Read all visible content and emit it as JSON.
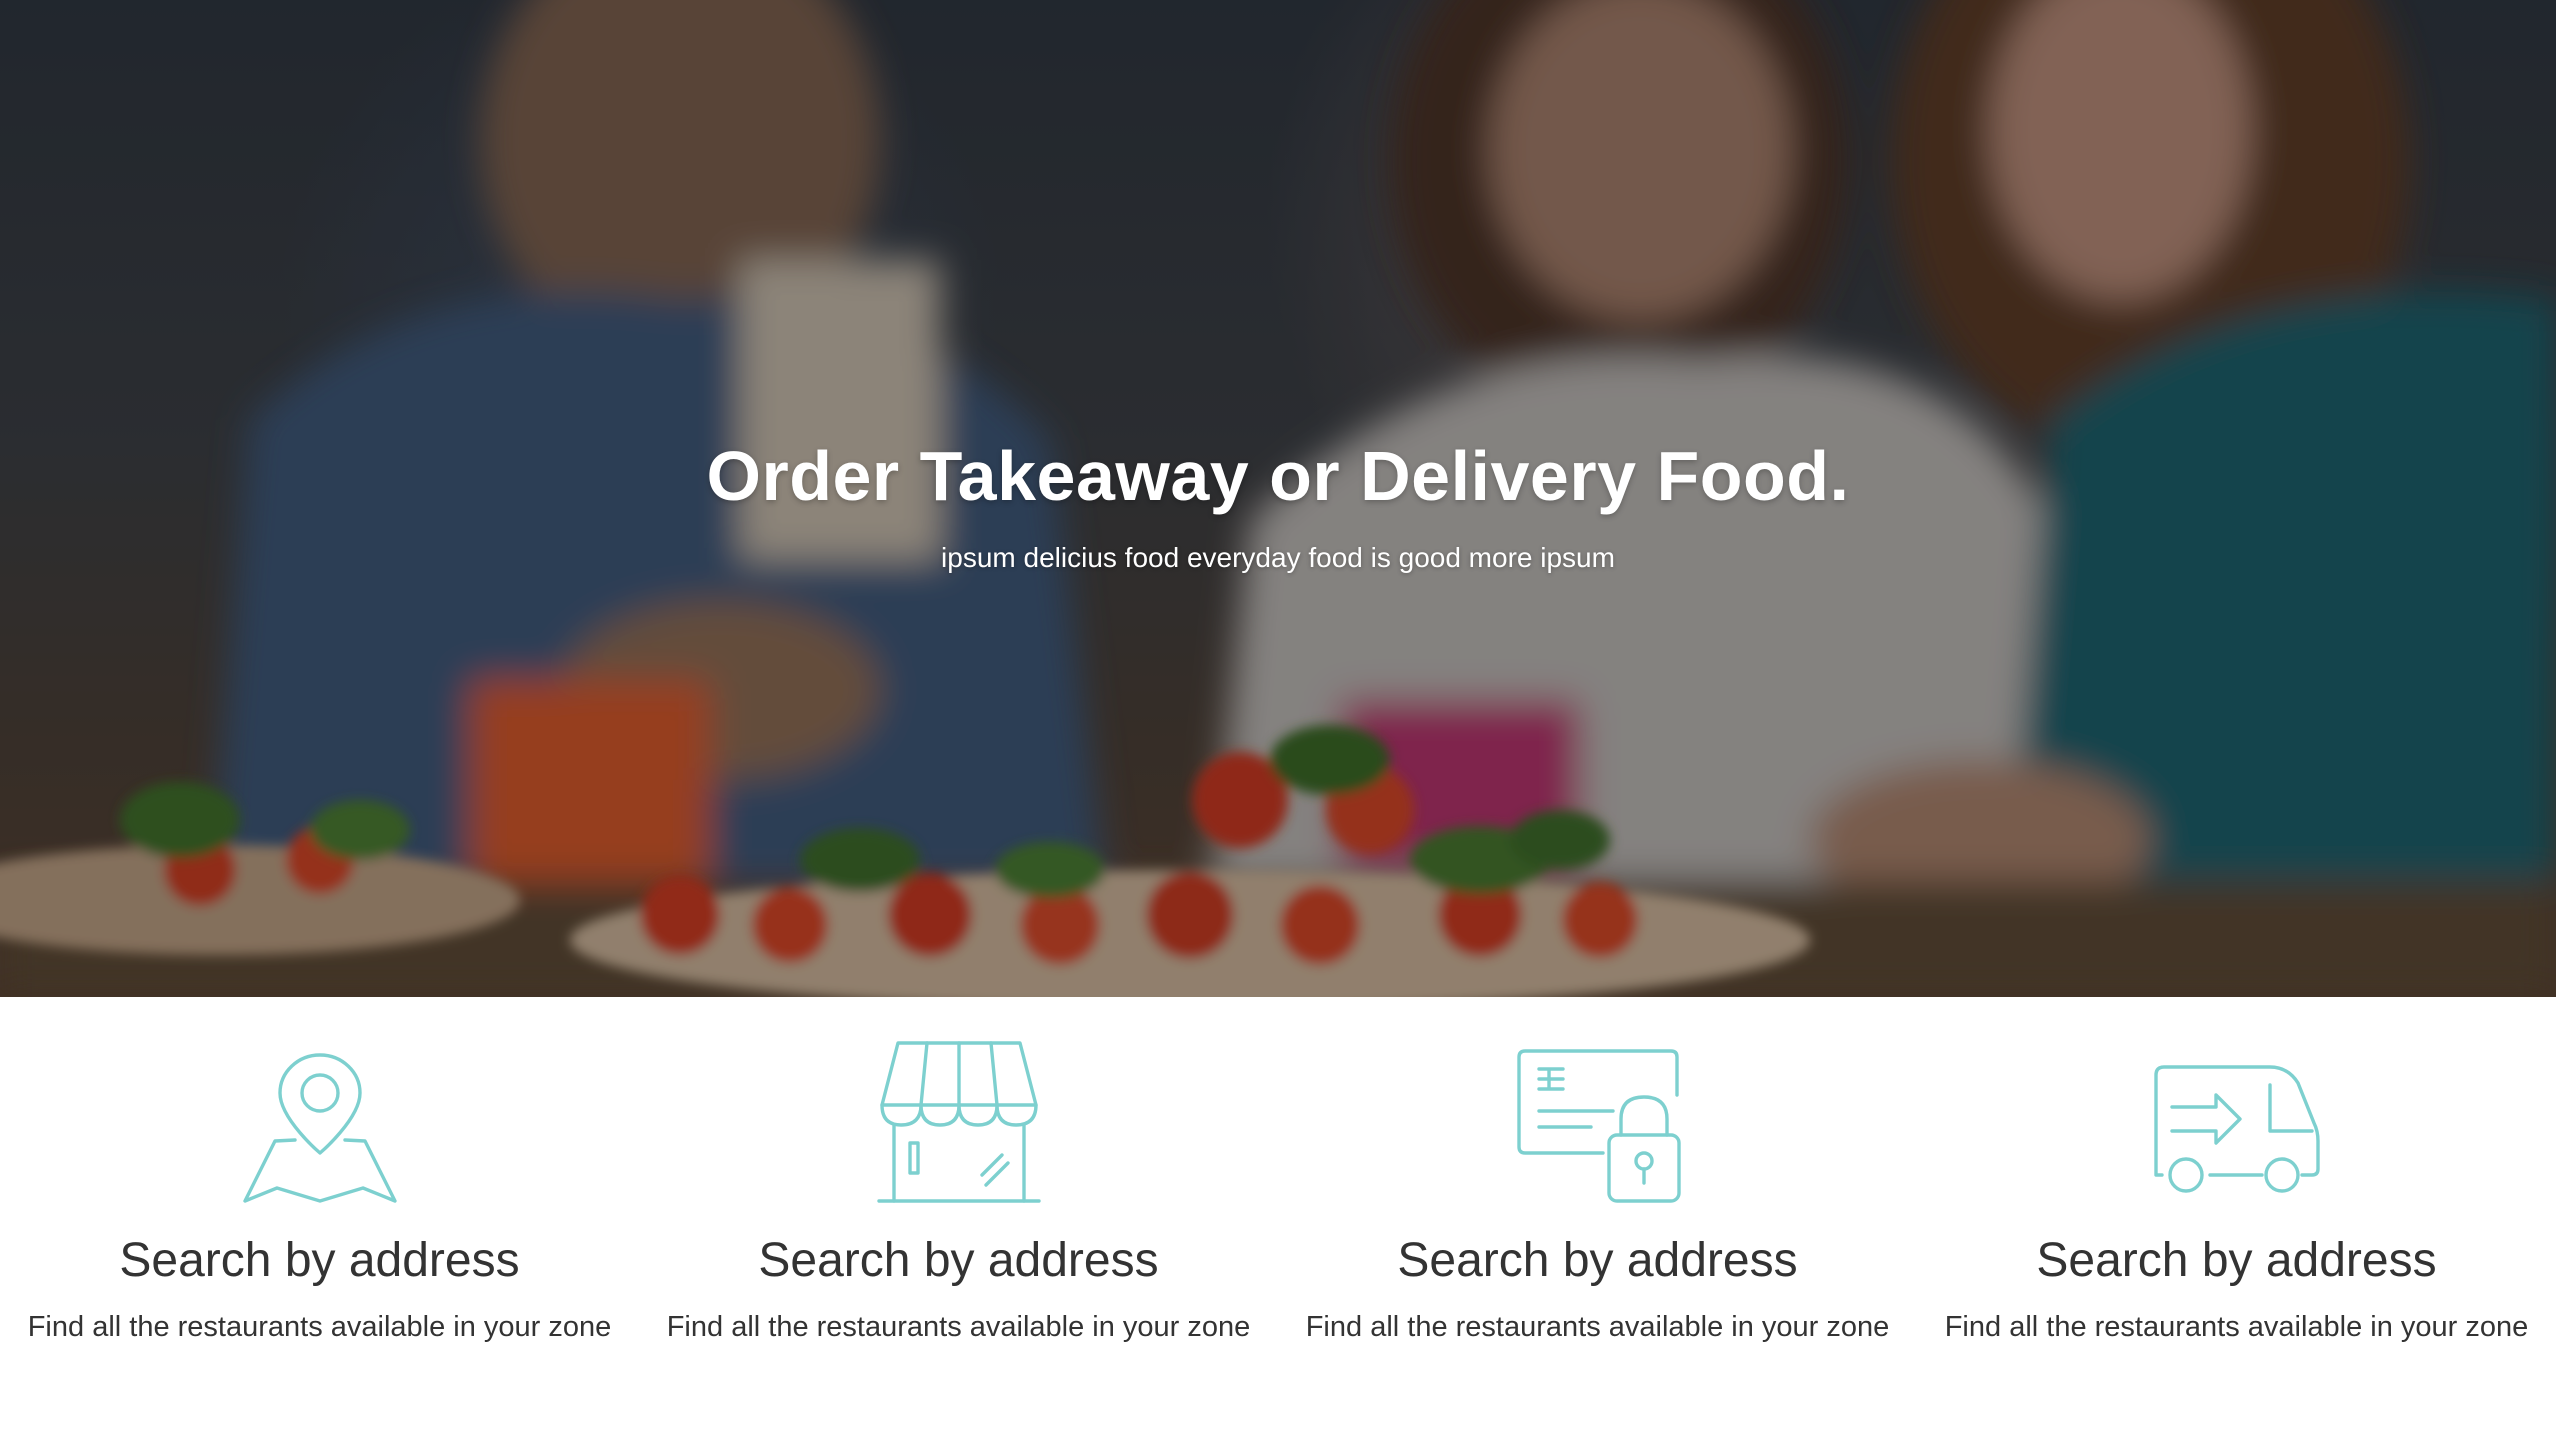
{
  "hero": {
    "title": "Order Takeaway or Delivery Food.",
    "subtitle": "ipsum delicius food everyday food is good more ipsum"
  },
  "colors": {
    "accent": "#7dd0cf",
    "text": "#333333"
  },
  "features": [
    {
      "icon": "map-pin-icon",
      "title": "Search by address",
      "description": "Find all the restaurants available in your zone"
    },
    {
      "icon": "storefront-icon",
      "title": "Search by address",
      "description": "Find all the restaurants available in your zone"
    },
    {
      "icon": "secure-card-icon",
      "title": "Search by address",
      "description": "Find all the restaurants available in your zone"
    },
    {
      "icon": "delivery-van-icon",
      "title": "Search by address",
      "description": "Find all the restaurants available in your zone"
    }
  ]
}
